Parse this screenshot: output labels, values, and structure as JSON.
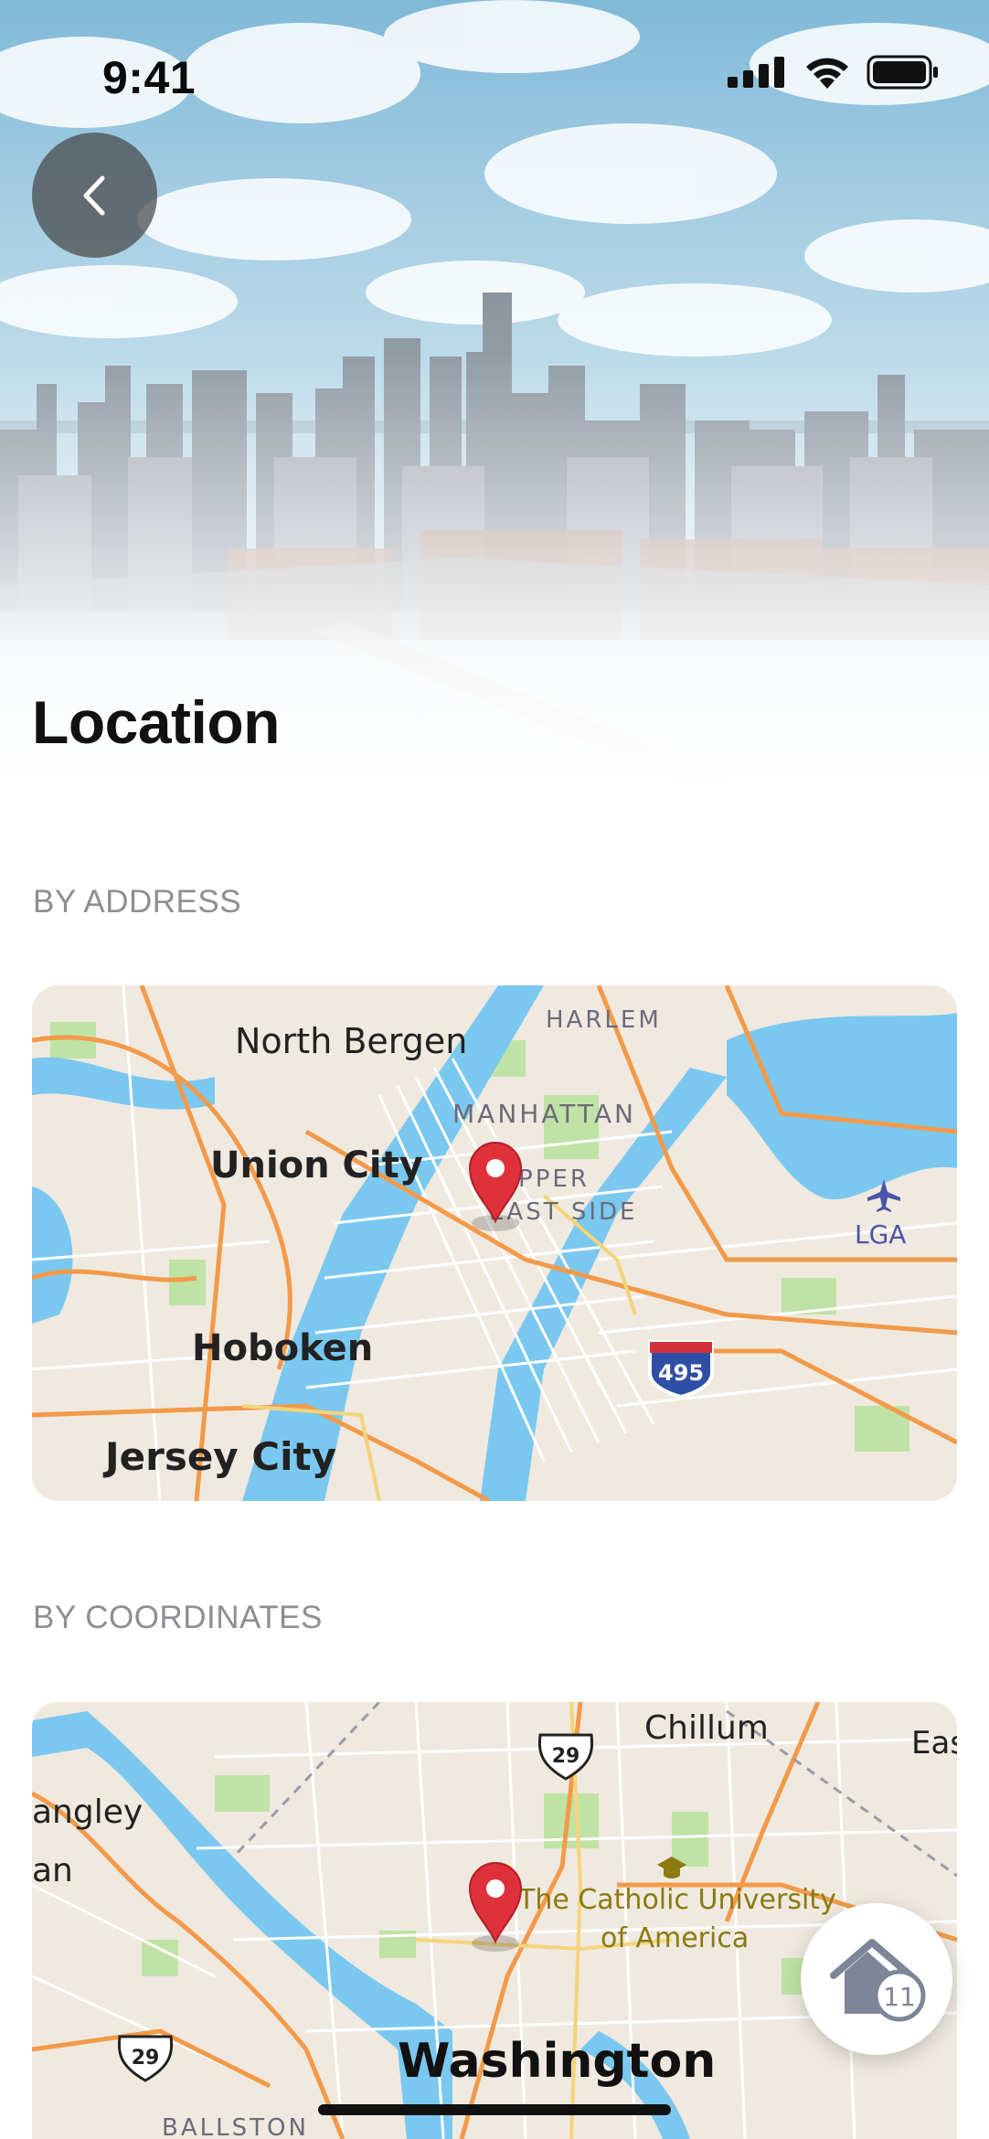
{
  "status": {
    "time": "9:41"
  },
  "header": {
    "title": "Location",
    "back_icon": "chevron-left-icon"
  },
  "sections": {
    "address": {
      "label": "BY ADDRESS",
      "map": {
        "labels": {
          "harlem": "HARLEM",
          "north_bergen": "North Bergen",
          "manhattan": "MANHATTAN",
          "union_city": "Union City",
          "upper_east_1": "UPPER",
          "upper_east_2": "EAST SIDE",
          "lga": "LGA",
          "hoboken": "Hoboken",
          "jersey_city": "Jersey City",
          "shield": "495"
        }
      }
    },
    "coordinates": {
      "label": "BY COORDINATES",
      "map": {
        "labels": {
          "chillum": "Chillum",
          "east": "Eas",
          "shield_top": "29",
          "langley": "angley",
          "an": "an",
          "catholic_1": "The Catholic University",
          "catholic_2": "of America",
          "shield_bottom": "29",
          "washington": "Washington",
          "ballston": "BALLSTON"
        }
      }
    }
  },
  "fab": {
    "icon": "home-icon",
    "badge": "11"
  },
  "colors": {
    "pin": "#e0303a",
    "water": "#7ac8f0",
    "road": "#f39a4a",
    "land": "#efe9df"
  }
}
